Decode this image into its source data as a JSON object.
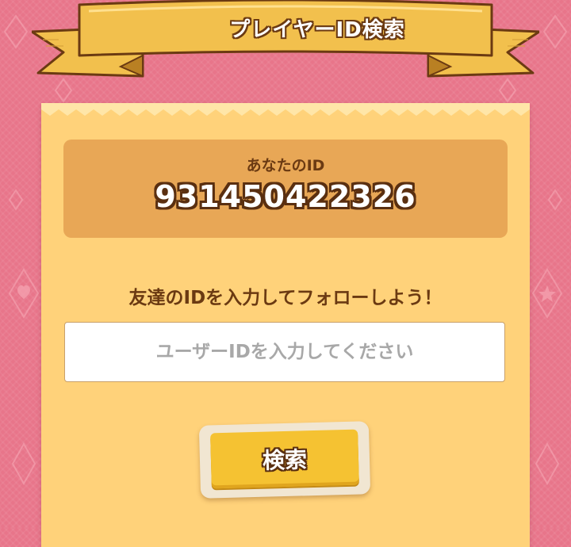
{
  "header": {
    "title": "プレイヤーID検索"
  },
  "my_id": {
    "label": "あなたのID",
    "value": "931450422326"
  },
  "follow": {
    "prompt": "友達のIDを入力してフォローしよう！",
    "input_placeholder": "ユーザーIDを入力してください",
    "input_value": "",
    "search_label": "検索"
  },
  "colors": {
    "background": "#e8758a",
    "panel": "#ffd27a",
    "id_box": "#e8a756",
    "ribbon": "#f2c04d",
    "text_brown": "#6b3a12",
    "button": "#f5c232"
  },
  "icons": [
    "diamond-pattern",
    "heart-icon",
    "star-icon"
  ]
}
